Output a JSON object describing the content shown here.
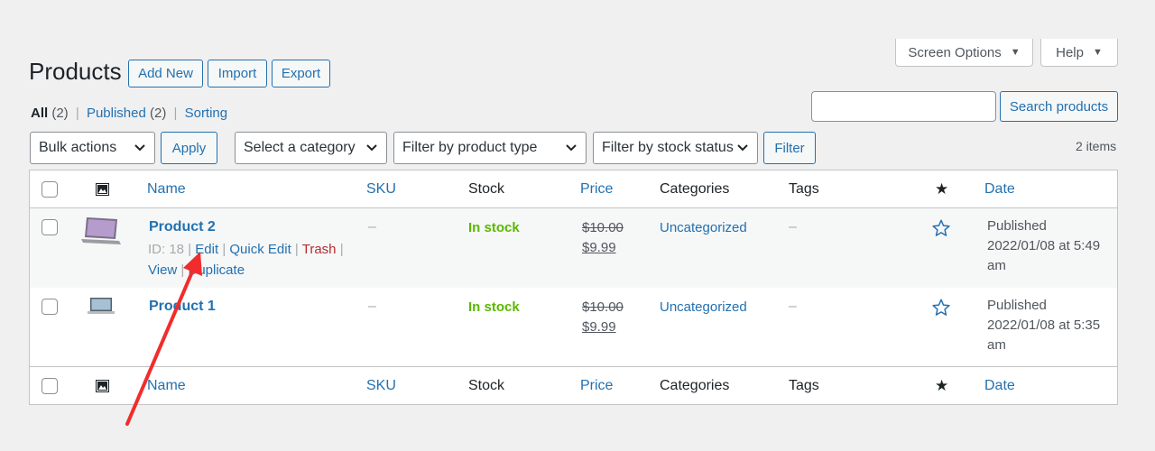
{
  "header": {
    "title": "Products",
    "add_new": "Add New",
    "import": "Import",
    "export": "Export",
    "screen_options": "Screen Options",
    "help": "Help"
  },
  "subsubsub": {
    "all": "All",
    "all_count": "(2)",
    "published": "Published",
    "published_count": "(2)",
    "sorting": "Sorting",
    "sep": "|"
  },
  "search": {
    "value": "",
    "button": "Search products"
  },
  "tablenav": {
    "bulk_actions": "Bulk actions",
    "apply": "Apply",
    "category": "Select a category",
    "product_type": "Filter by product type",
    "stock_status": "Filter by stock status",
    "filter": "Filter",
    "items": "2 items"
  },
  "columns": {
    "name": "Name",
    "sku": "SKU",
    "stock": "Stock",
    "price": "Price",
    "categories": "Categories",
    "tags": "Tags",
    "date": "Date"
  },
  "rows": [
    {
      "name": "Product 2",
      "id_label": "ID: 18",
      "edit": "Edit",
      "quick_edit": "Quick Edit",
      "trash": "Trash",
      "view": "View",
      "duplicate": "Duplicate",
      "sku": "–",
      "stock": "In stock",
      "regular_price": "$10.00",
      "sale_price": "$9.99",
      "category": "Uncategorized",
      "tags": "–",
      "status": "Published",
      "date_line1": "2022/01/08 at 5:49",
      "date_line2": "am"
    },
    {
      "name": "Product 1",
      "sku": "–",
      "stock": "In stock",
      "regular_price": "$10.00",
      "sale_price": "$9.99",
      "category": "Uncategorized",
      "tags": "–",
      "status": "Published",
      "date_line1": "2022/01/08 at 5:35",
      "date_line2": "am"
    }
  ],
  "colors": {
    "accent": "#2271b1",
    "in_stock": "#5ab900",
    "trash": "#b32d2e",
    "arrow": "#f22c2c"
  },
  "icons": [
    "image-icon",
    "featured-star-icon",
    "star-outline-icon",
    "chevron-down-icon",
    "caret-down-icon"
  ]
}
